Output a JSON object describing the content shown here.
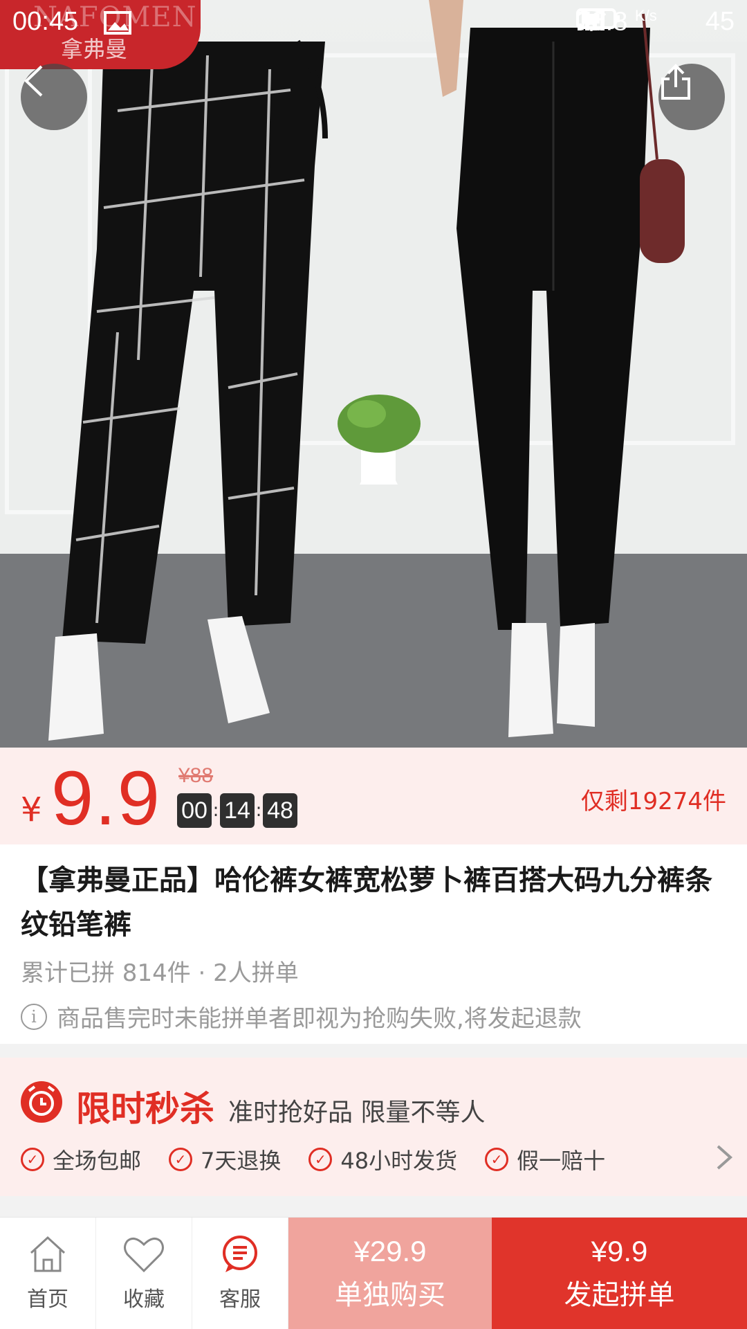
{
  "status_bar": {
    "time": "00:45",
    "speed": "70.8",
    "speed_unit": "K/s",
    "battery": "45"
  },
  "brand": {
    "en": "NAFOMEN",
    "cn": "拿弗曼"
  },
  "price": {
    "currency": "¥",
    "current": "9.9",
    "original": "¥88",
    "countdown": [
      "00",
      "14",
      "48"
    ],
    "stock_text": "仅剩19274件"
  },
  "product": {
    "title": "【拿弗曼正品】哈伦裤女裤宽松萝卜裤百搭大码九分裤条纹铅笔裤",
    "sold_text": "累计已拼 814件 · 2人拼单",
    "notice": "商品售完时未能拼单者即视为抢购失败,将发起退款"
  },
  "flash_sale": {
    "title": "限时秒杀",
    "subtitle": "准时抢好品 限量不等人",
    "guarantees": [
      "全场包邮",
      "7天退换",
      "48小时发货",
      "假一赔十"
    ]
  },
  "bottom_bar": {
    "home": "首页",
    "favorite": "收藏",
    "service": "客服",
    "buy_alone_price": "¥29.9",
    "buy_alone_label": "单独购买",
    "group_price": "¥9.9",
    "group_label": "发起拼单"
  },
  "colors": {
    "accent_red": "#e02e24",
    "price_band": "#fdeeed",
    "buy_alone_bg": "#f0a49d",
    "group_bg": "#e0342b"
  }
}
